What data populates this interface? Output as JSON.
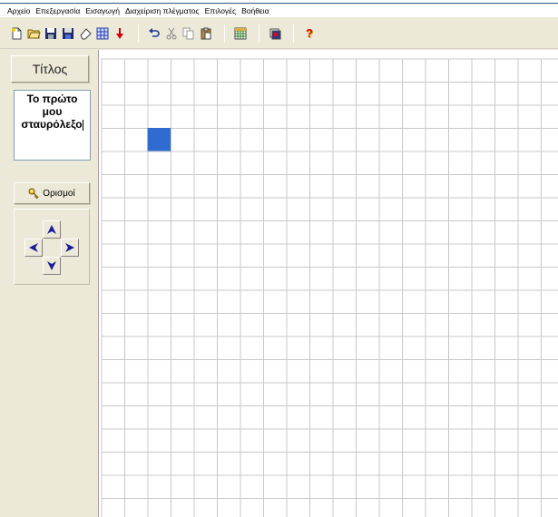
{
  "menu": [
    "Αρχείο",
    "Επεξεργασία",
    "Εισαγωγή",
    "Διαχείριση πλέγματος",
    "Επιλογές",
    "Βοήθεια"
  ],
  "toolbar": {
    "icons": [
      "new-file-icon",
      "open-folder-icon",
      "save-icon",
      "save-as-icon",
      "eraser-icon",
      "grid-pattern-icon",
      "red-arrow-icon",
      "undo-icon",
      "cut-icon",
      "copy-icon",
      "paste-icon",
      "grid-table-icon",
      "print-preview-icon",
      "help-icon"
    ]
  },
  "left_panel": {
    "title_button": "Τίτλος",
    "title_text": "Το πρώτο\nμου\nσταυρόλεξο",
    "definitions_button": "Ορισμοί"
  },
  "grid": {
    "columns": 20,
    "rows": 20,
    "cell_color": "#ffffff",
    "line_color": "#c8c8c8",
    "selected_cell": {
      "row": 3,
      "col": 2,
      "color": "#2f6bd1"
    }
  }
}
